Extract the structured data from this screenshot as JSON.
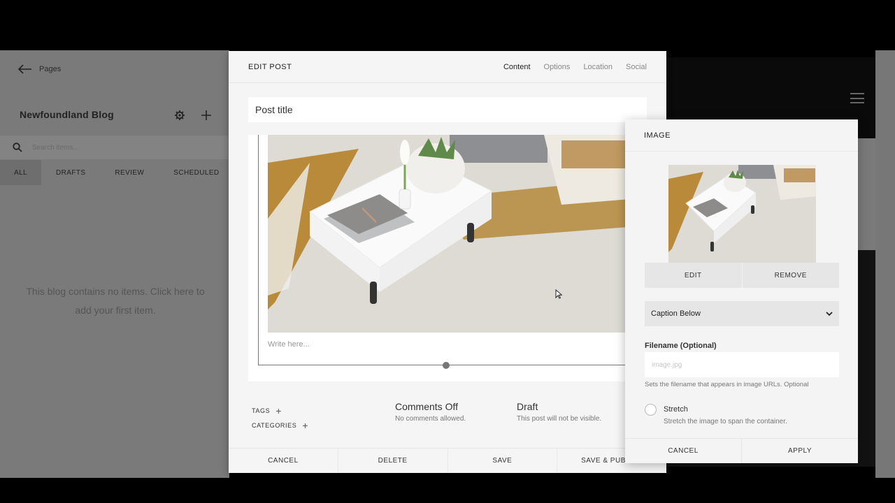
{
  "sidebar": {
    "back_label": "Pages",
    "blog_title": "Newfoundland Blog",
    "search_placeholder": "Search items...",
    "tabs": [
      {
        "label": "ALL",
        "active": true
      },
      {
        "label": "DRAFTS",
        "active": false
      },
      {
        "label": "REVIEW",
        "active": false
      },
      {
        "label": "SCHEDULED",
        "active": false
      }
    ],
    "empty_message": "This blog contains no items. Click here to add your first item."
  },
  "edit_post": {
    "title": "EDIT POST",
    "tabs": [
      {
        "label": "Content",
        "active": true
      },
      {
        "label": "Options",
        "active": false
      },
      {
        "label": "Location",
        "active": false
      },
      {
        "label": "Social",
        "active": false
      }
    ],
    "post_title_placeholder": "Post title",
    "body_placeholder": "Write here...",
    "tags_label": "TAGS",
    "categories_label": "CATEGORIES",
    "comments": {
      "heading": "Comments Off",
      "subtext": "No comments allowed."
    },
    "status": {
      "heading": "Draft",
      "subtext": "This post will not be visible."
    },
    "footer": {
      "cancel": "CANCEL",
      "delete": "DELETE",
      "save": "SAVE",
      "save_publish": "SAVE & PUBLISH"
    }
  },
  "image_panel": {
    "title": "IMAGE",
    "edit_label": "EDIT",
    "remove_label": "REMOVE",
    "caption_option": "Caption Below",
    "filename_label": "Filename (Optional)",
    "filename_placeholder": "image.jpg",
    "filename_help": "Sets the filename that appears in image URLs. Optional",
    "stretch_label": "Stretch",
    "stretch_help": "Stretch the image to span the container.",
    "cancel_label": "CANCEL",
    "apply_label": "APPLY"
  },
  "colors": {
    "overlay": "#7a7a7a",
    "panel_bg": "#f5f5f5",
    "button_bg": "#e6e6e6"
  }
}
